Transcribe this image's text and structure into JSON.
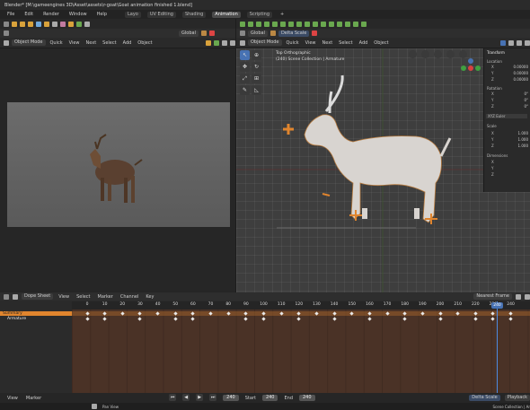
{
  "window": {
    "title": "Blender* [M:\\gameengines 3D\\Asset\\assets\\r-goat\\Goat animation finished 1.blend]"
  },
  "menu": [
    "File",
    "Edit",
    "Render",
    "Window",
    "Help"
  ],
  "workspaces": [
    {
      "label": "Layo"
    },
    {
      "label": "UV Editing"
    },
    {
      "label": "Shading"
    },
    {
      "label": "Animation"
    },
    {
      "label": "Scripting"
    }
  ],
  "workspace_add": "+",
  "left_toolbar": {
    "orientation": "Global",
    "mode_label": "Object Mode",
    "menus": [
      "Quick",
      "View",
      "Next",
      "Select",
      "Add",
      "Object"
    ]
  },
  "right_toolbar": {
    "orientation": "Global",
    "mode_label": "Object Mode",
    "menus": [
      "Quick",
      "View",
      "Next",
      "Select",
      "Add",
      "Object"
    ]
  },
  "scale_field": "Delta Scale",
  "viewport_overlay": {
    "line1": "Top Orthographic",
    "line2": "(240) Scene Collection | Armature"
  },
  "n_panel": {
    "title": "Transform",
    "location_label": "Location",
    "location": [
      {
        "axis": "X",
        "value": "0.00000"
      },
      {
        "axis": "Y",
        "value": "0.00000"
      },
      {
        "axis": "Z",
        "value": "0.00000"
      }
    ],
    "rotation_label": "Rotation",
    "rotation": [
      {
        "axis": "X",
        "value": "0°"
      },
      {
        "axis": "Y",
        "value": "0°"
      },
      {
        "axis": "Z",
        "value": "0°"
      }
    ],
    "rotation_mode": "XYZ Euler",
    "scale_label": "Scale",
    "scale": [
      {
        "axis": "X",
        "value": "1.000"
      },
      {
        "axis": "Y",
        "value": "1.000"
      },
      {
        "axis": "Z",
        "value": "1.000"
      }
    ],
    "dimensions_label": "Dimensions",
    "dimensions": [
      {
        "axis": "X",
        "value": ""
      },
      {
        "axis": "Y",
        "value": ""
      },
      {
        "axis": "Z",
        "value": ""
      }
    ]
  },
  "dopesheet": {
    "mode": "Dope Sheet",
    "menus": [
      "View",
      "Select",
      "Marker",
      "Channel",
      "Key"
    ],
    "snap": "Nearest Frame",
    "ruler": [
      "0",
      "10",
      "20",
      "30",
      "40",
      "50",
      "60",
      "70",
      "80",
      "90",
      "100",
      "110",
      "120",
      "130",
      "140",
      "150",
      "160",
      "170",
      "180",
      "190",
      "200",
      "210",
      "220",
      "230",
      "240"
    ],
    "current_frame": "240",
    "channels": [
      {
        "label": "Summary",
        "selected": true
      },
      {
        "label": "Armature",
        "selected": false
      }
    ],
    "summary_keys": [
      0,
      10,
      20,
      30,
      40,
      50,
      60,
      70,
      80,
      90,
      100,
      110,
      120,
      130,
      140,
      150,
      160,
      170,
      180,
      190,
      200,
      210,
      220,
      230,
      240
    ],
    "armature_keys": [
      0,
      10,
      30,
      50,
      60,
      90,
      100,
      120,
      140,
      160,
      180,
      200,
      220,
      230,
      240
    ]
  },
  "playback": {
    "menus": [
      "View",
      "Marker"
    ],
    "playback_label": "Playback",
    "frame": "240",
    "start_label": "Start",
    "start": "240",
    "end_label": "End",
    "end": "240",
    "scale_field": "Delta Scale"
  },
  "statusbar": {
    "left": "Pan View",
    "right": "Scene Collection | Ar"
  },
  "colors": {
    "accent": "#4772b3",
    "timeline_bg": "#4a3226",
    "summary_row": "#e0852e"
  }
}
